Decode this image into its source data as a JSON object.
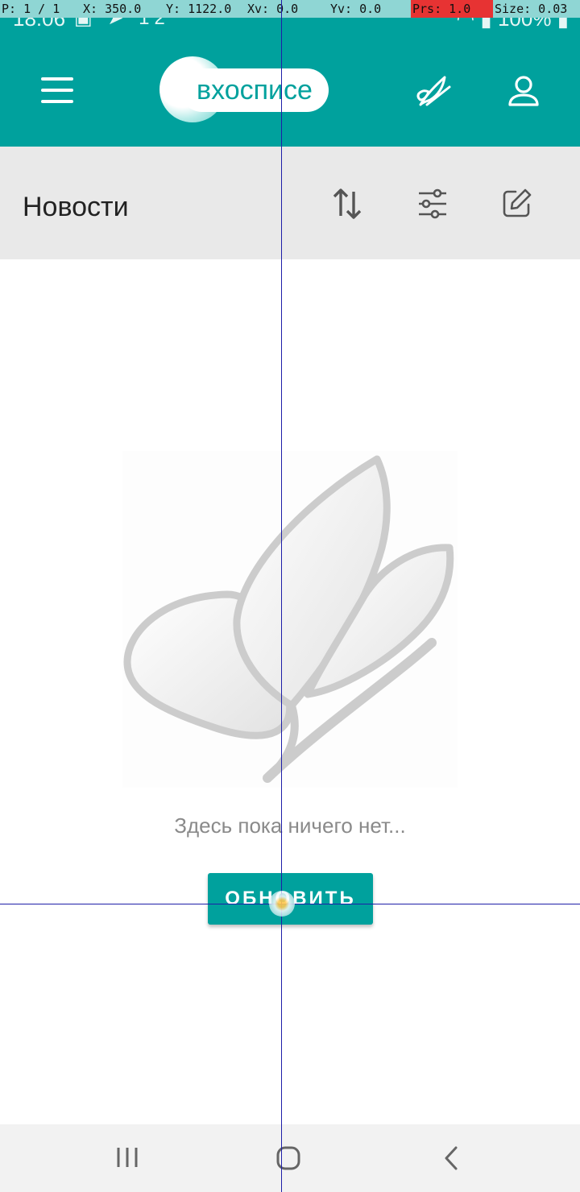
{
  "status_bar": {
    "time": "18:06",
    "notif_count": "12",
    "battery": "100%"
  },
  "debug_overlay": {
    "pointer": "P: 1 / 1",
    "x": "X: 350.0",
    "y": "Y: 1122.0",
    "xv": "Xv: 0.0",
    "yv": "Yv: 0.0",
    "prs": "Prs: 1.0",
    "size": "Size: 0.03"
  },
  "header": {
    "logo_text": "вхосписе",
    "menu_icon": "hamburger-menu-icon",
    "pen_icon": "feather-pen-icon",
    "profile_icon": "user-icon"
  },
  "toolbar": {
    "title": "Новости",
    "sort_icon": "sort-icon",
    "filter_icon": "filter-sliders-icon",
    "edit_icon": "edit-icon"
  },
  "empty_state": {
    "message": "Здесь пока ничего нет...",
    "refresh_label": "ОБНОВИТЬ",
    "illustration": "butterfly-icon"
  },
  "nav": {
    "recents_icon": "recents-icon",
    "home_icon": "home-icon",
    "back_icon": "back-icon"
  },
  "colors": {
    "primary": "#00a19d",
    "subbar": "#e9e9e9",
    "accent_text": "#8a8a8a"
  }
}
